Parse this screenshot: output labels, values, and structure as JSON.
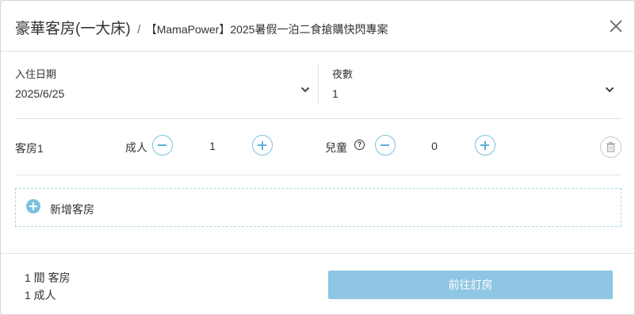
{
  "header": {
    "room_name": "豪華客房(一大床)",
    "separator": "/",
    "plan_name": "【MamaPower】2025暑假一泊二食搶購快閃專案"
  },
  "checkin": {
    "label": "入住日期",
    "value": "2025/6/25"
  },
  "nights": {
    "label": "夜數",
    "value": "1"
  },
  "room": {
    "label": "客房1",
    "adults_label": "成人",
    "adults_count": "1",
    "children_label": "兒童",
    "children_count": "0"
  },
  "add_room": {
    "label": "新增客房"
  },
  "footer": {
    "rooms_summary": "1 間 客房",
    "guests_summary": "1 成人",
    "book_button": "前往訂房"
  },
  "colors": {
    "accent": "#7cc1de",
    "button": "#8ec6e3"
  },
  "icons": [
    "close-icon",
    "chevron-down-icon",
    "minus-icon",
    "plus-icon",
    "help-icon",
    "trash-icon",
    "add-circle-icon"
  ]
}
